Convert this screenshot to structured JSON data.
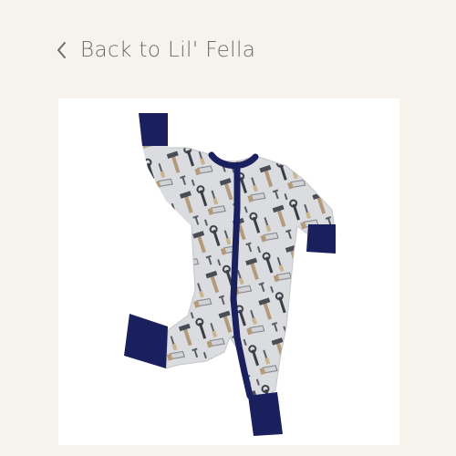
{
  "nav": {
    "back_label": "Back to Lil' Fella",
    "back_icon": "chevron-left-icon"
  },
  "product": {
    "image_subject": "zip romper with tool print",
    "trim_color": "#1a1f5e",
    "fabric_color": "#dadcdf"
  }
}
